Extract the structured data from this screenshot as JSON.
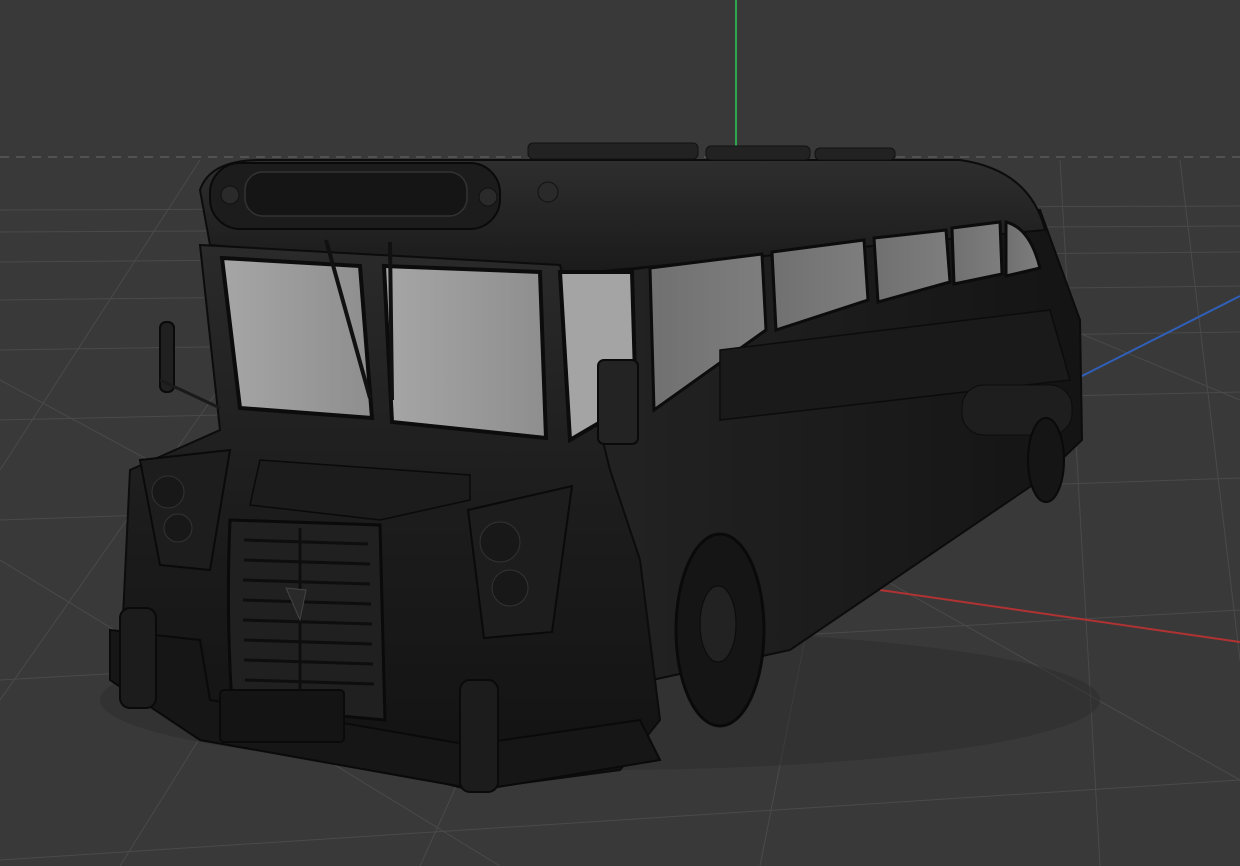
{
  "viewport": {
    "background": "#393939",
    "grid_color": "#4a4a4a",
    "axis_colors": {
      "x": "#b03232",
      "y": "#2fa84f",
      "z": "#2f5fb8"
    },
    "model": {
      "name": "bus-model",
      "material": "dark-grey-shaded",
      "window_color": "#9a9a9a"
    }
  }
}
